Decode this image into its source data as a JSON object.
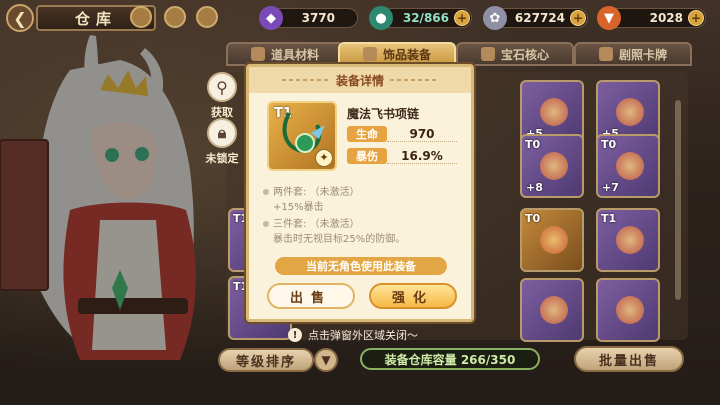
{
  "topbar": {
    "back_icon": "back-icon",
    "title": "仓库",
    "resources": [
      {
        "name": "crystal",
        "icon": "crystal-icon",
        "value": "3770",
        "color": "#a06ad8"
      },
      {
        "name": "stamina",
        "icon": "stamina-icon",
        "value": "32/866",
        "color": "#3aa58a"
      },
      {
        "name": "coin",
        "icon": "coin-icon",
        "value": "627724",
        "color": "#b9b9c9"
      },
      {
        "name": "carrot",
        "icon": "carrot-icon",
        "value": "2028",
        "color": "#e8782a"
      }
    ]
  },
  "tabs": [
    {
      "label": "道具材料",
      "active": false
    },
    {
      "label": "饰品装备",
      "active": true
    },
    {
      "label": "宝石核心",
      "active": false
    },
    {
      "label": "剧照卡牌",
      "active": false
    }
  ],
  "side": {
    "acquire_label": "获取",
    "lock_label": "未锁定"
  },
  "grid": {
    "items": [
      {
        "tier": "",
        "level": "+5",
        "gold": false
      },
      {
        "tier": "",
        "level": "+5",
        "gold": false
      },
      {
        "tier": "T0",
        "level": "+8",
        "gold": false
      },
      {
        "tier": "T0",
        "level": "+7",
        "gold": false
      },
      {
        "tier": "T0",
        "level": "",
        "gold": true
      },
      {
        "tier": "T1",
        "level": "",
        "gold": false
      },
      {
        "tier": "T1",
        "level": "",
        "gold": false
      },
      {
        "tier": "T1",
        "level": "",
        "gold": false
      },
      {
        "tier": "",
        "level": "",
        "gold": false
      }
    ]
  },
  "popup": {
    "header": "装备详情",
    "item_tier": "T1",
    "item_name": "魔法飞书项链",
    "stats": [
      {
        "label": "生命",
        "value": "970"
      },
      {
        "label": "暴伤",
        "value": "16.9%"
      }
    ],
    "set2_title": "两件套:  （未激活）",
    "set2_desc": "+15%暴击",
    "set3_title": "三件套:  （未激活）",
    "set3_desc": "暴击时无视目标25%的防御。",
    "status": "当前无角色使用此装备",
    "sell_label": "出售",
    "upgrade_label": "强化"
  },
  "hint": "点击弹窗外区域关闭～",
  "bottom": {
    "sort_label": "等级排序",
    "capacity": "装备仓库容量 266/350",
    "bulk_sell_label": "批量出售"
  }
}
